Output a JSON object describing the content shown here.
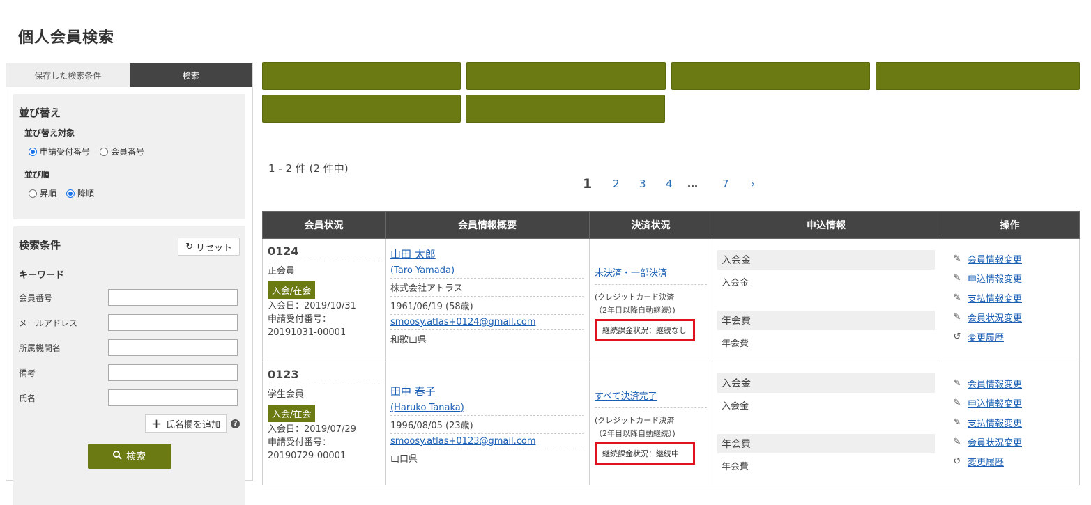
{
  "page": {
    "title": "個人会員検索"
  },
  "sidebar": {
    "tabs": [
      {
        "label": "保存した検索条件",
        "active": false
      },
      {
        "label": "検索",
        "active": true
      }
    ],
    "sort": {
      "title": "並び替え",
      "target_label": "並び替え対象",
      "target_options": [
        {
          "label": "申請受付番号",
          "checked": true
        },
        {
          "label": "会員番号",
          "checked": false
        }
      ],
      "order_label": "並び順",
      "order_options": [
        {
          "label": "昇順",
          "checked": false
        },
        {
          "label": "降順",
          "checked": true
        }
      ]
    },
    "search": {
      "title": "検索条件",
      "reset_label": "リセット",
      "keyword_label": "キーワード",
      "fields": [
        {
          "label": "会員番号",
          "value": ""
        },
        {
          "label": "メールアドレス",
          "value": ""
        },
        {
          "label": "所属機関名",
          "value": ""
        },
        {
          "label": "備考",
          "value": ""
        },
        {
          "label": "氏名",
          "value": ""
        }
      ],
      "add_name_label": "氏名欄を追加",
      "help_mark": "?",
      "search_button": "検索"
    }
  },
  "action_buttons_count": 6,
  "results": {
    "count_text": "1 - 2 件 (2 件中)",
    "pagination": {
      "current": "1",
      "pages": [
        "2",
        "3",
        "4"
      ],
      "ellipsis": "…",
      "last": "7",
      "next": "›"
    },
    "headers": [
      "会員状況",
      "会員情報概要",
      "決済状況",
      "申込情報",
      "操作"
    ],
    "rows": [
      {
        "member_no": "0124",
        "member_type": "正会員",
        "badge": "入会/在会",
        "join_date": "入会日：2019/10/31",
        "app_no_label": "申請受付番号：",
        "app_no": "20191031-00001",
        "name": "山田 太郎",
        "name_en": "(Taro Yamada)",
        "org": "株式会社アトラス",
        "birth": "1961/06/19 (58歳)",
        "email": "smoosy.atlas+0124@gmail.com",
        "prefecture": "和歌山県",
        "pay_status": "未決済・一部決済",
        "pay_note_1": "(クレジットカード決済",
        "pay_note_2": "（2年目以降自動継続）)",
        "continue_status": "継続課金状況：継続なし",
        "fees": [
          {
            "head": "入会金",
            "value": "入会金"
          },
          {
            "head": "年会費",
            "value": "年会費"
          }
        ],
        "ops": [
          "会員情報変更",
          "申込情報変更",
          "支払情報変更",
          "会員状況変更",
          "変更履歴"
        ]
      },
      {
        "member_no": "0123",
        "member_type": "学生会員",
        "badge": "入会/在会",
        "join_date": "入会日：2019/07/29",
        "app_no_label": "申請受付番号：",
        "app_no": "20190729-00001",
        "name": "田中 春子",
        "name_en": "(Haruko Tanaka)",
        "org": "",
        "birth": "1996/08/05 (23歳)",
        "email": "smoosy.atlas+0123@gmail.com",
        "prefecture": "山口県",
        "pay_status": "すべて決済完了",
        "pay_note_1": "(クレジットカード決済",
        "pay_note_2": "（2年目以降自動継続）)",
        "continue_status": "継続課金状況：継続中",
        "fees": [
          {
            "head": "入会金",
            "value": "入会金"
          },
          {
            "head": "年会費",
            "value": "年会費"
          }
        ],
        "ops": [
          "会員情報変更",
          "申込情報変更",
          "支払情報変更",
          "会員状況変更",
          "変更履歴"
        ]
      }
    ]
  },
  "colors": {
    "accent": "#6b7a12",
    "header_bg": "#444444",
    "link": "#1a5fb4",
    "highlight": "#e0141e"
  }
}
